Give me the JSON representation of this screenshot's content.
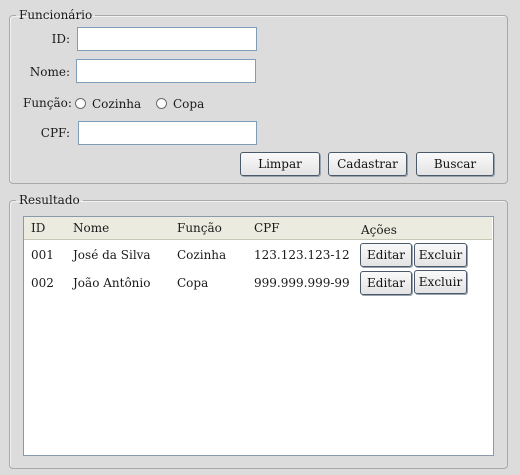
{
  "form": {
    "legend": "Funcionário",
    "id_label": "ID:",
    "id_value": "",
    "name_label": "Nome:",
    "name_value": "",
    "role_label": "Função:",
    "role_options": [
      "Cozinha",
      "Copa"
    ],
    "cpf_label": "CPF:",
    "cpf_value": "",
    "clear_button": "Limpar",
    "register_button": "Cadastrar",
    "search_button": "Buscar"
  },
  "results": {
    "legend": "Resultado",
    "columns": [
      "ID",
      "Nome",
      "Função",
      "CPF",
      "Ações"
    ],
    "rows": [
      {
        "id": "001",
        "name": "José da Silva",
        "role": "Cozinha",
        "cpf": "123.123.123-12",
        "edit": "Editar",
        "delete": "Excluir"
      },
      {
        "id": "002",
        "name": "João Antônio",
        "role": "Copa",
        "cpf": "999.999.999-99",
        "edit": "Editar",
        "delete": "Excluir"
      }
    ]
  }
}
